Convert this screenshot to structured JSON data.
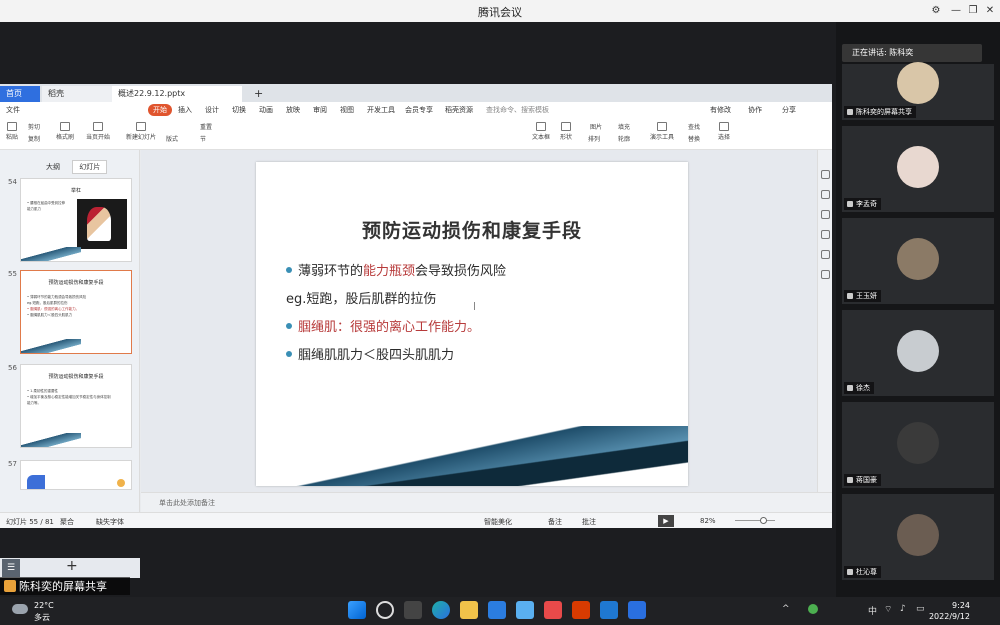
{
  "window": {
    "title": "腾讯会议",
    "controls": [
      "settings",
      "minimize",
      "maximize",
      "close"
    ]
  },
  "wps": {
    "tabs": {
      "home": "首页",
      "wps": "稻壳",
      "file": "概述22.9.12.pptx"
    },
    "menu": {
      "file": "文件",
      "start": "开始",
      "insert": "插入",
      "design": "设计",
      "switch": "切换",
      "animation": "动画",
      "show": "放映",
      "review": "审阅",
      "view": "视图",
      "devtools": "开发工具",
      "member": "会员专享",
      "dockertemplates": "稻壳资源",
      "search": "查找命令、搜索模板",
      "unmodified": "有修改",
      "collab": "协作",
      "share": "分享"
    },
    "ribbon": {
      "paste": "粘贴",
      "cut": "剪切",
      "copy": "复制",
      "format": "格式刷",
      "current_start": "当页开始",
      "new_slide": "新建幻灯片",
      "layout": "版式",
      "section": "节",
      "reset": "重置",
      "textbox": "文本框",
      "shape": "形状",
      "arrange": "排列",
      "picture": "图片",
      "fill": "填充",
      "outline": "轮廓",
      "present_tools": "演示工具",
      "find": "查找",
      "replace": "替换",
      "select": "选择",
      "convert": "转换",
      "text_dir": "文字方向"
    },
    "panel": {
      "outline_tab": "大纲",
      "slides_tab": "幻灯片",
      "thumbs": [
        {
          "num": "54",
          "title": "举杠",
          "lines": [
            "• 腰椎在屈曲中受到拉伸",
            "  能力肌力"
          ]
        },
        {
          "num": "55",
          "title": "预防运动损伤和康复手段",
          "lines": [
            "• 薄弱环节的能力瓶颈会导致损伤风险",
            "eg.短跑，股后肌群的拉伤",
            "• 腘绳肌：很强的离心工作能力。",
            "• 腘绳肌肌力＜股四头肌肌力"
          ]
        },
        {
          "num": "56",
          "title": "预防运动损伤和康复手段",
          "lines": [
            "• 1.柔韧性的重要性",
            "• 增加平衡及核心稳定性能增加关节稳定性与身体控制",
            "  能力等。"
          ]
        },
        {
          "num": "57",
          "title": "",
          "lines": []
        }
      ]
    },
    "slide": {
      "title": "预防运动损伤和康复手段",
      "line1_pre": "薄弱环节的",
      "line1_red": "能力瓶颈",
      "line1_post": "会导致损伤风险",
      "line2": "eg.短跑，股后肌群的拉伤",
      "line3": "腘绳肌：很强的离心工作能力。",
      "line4": "腘绳肌肌力＜股四头肌肌力"
    },
    "notes_placeholder": "单击此处添加备注",
    "status": {
      "slide_count": "幻灯片 55 / 81",
      "theme": "聚合",
      "font_missing": "缺失字体",
      "smart_beautify": "智能美化",
      "notes": "备注",
      "comments": "批注",
      "zoom": "82%"
    }
  },
  "presenter_label": "陈科奕的屏幕共享",
  "participants": {
    "speaking": "正在讲话: 陈科奕",
    "tiles": [
      {
        "name": "陈科奕的屏幕共享",
        "color": "#d9c6a8"
      },
      {
        "name": "李孟奇",
        "color": "#e8d8d0"
      },
      {
        "name": "王玉妍",
        "color": "#8b7a66"
      },
      {
        "name": "徐杰",
        "color": "#c8ccd0"
      },
      {
        "name": "蒋国豪",
        "color": "#3a3a3a"
      },
      {
        "name": "杜沁尊",
        "color": "#6b5d52"
      }
    ]
  },
  "taskbar": {
    "temp": "22°C",
    "weather": "多云",
    "ime": "中",
    "time": "9:24",
    "date": "2022/9/12"
  }
}
